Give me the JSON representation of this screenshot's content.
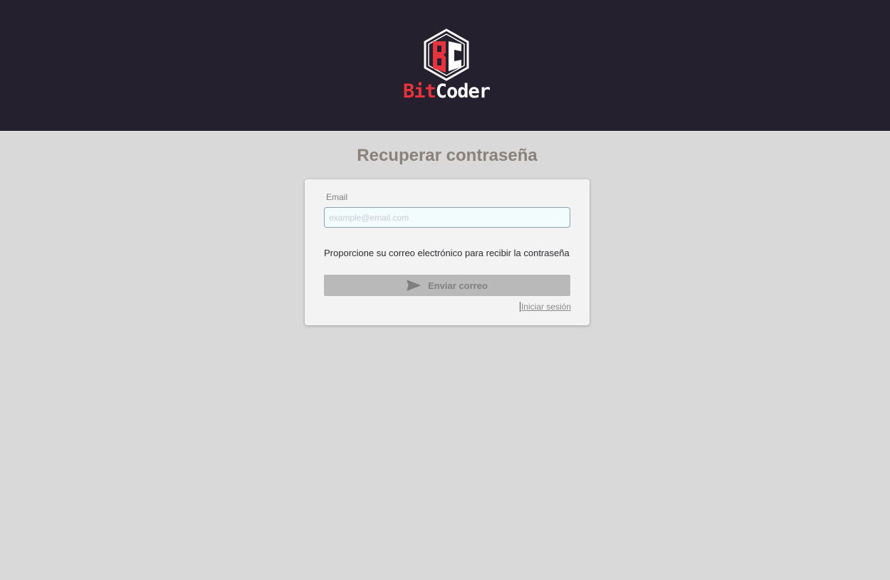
{
  "header": {
    "logo": {
      "emblem_letters": "BC",
      "word_part_1": "Bit",
      "word_part_2": "Coder",
      "colors": {
        "red": "#e8323c",
        "white": "#ffffff",
        "background": "#25202d"
      }
    }
  },
  "main": {
    "title": "Recuperar contraseña",
    "form": {
      "email_label": "Email",
      "email_value": "",
      "email_placeholder": "example@email.com",
      "help_text": "Proporcione su correo electrónico para recibir la contraseña",
      "send_button_label": "Enviar correo",
      "send_button_icon": "send-icon",
      "login_link_label": "Iniciar sesión"
    }
  }
}
